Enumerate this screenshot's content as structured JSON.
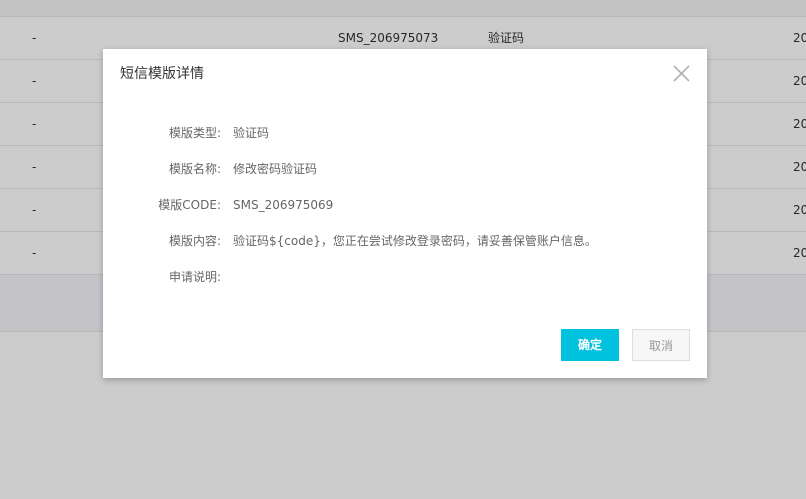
{
  "dialog": {
    "title": "短信模版详情",
    "fields": [
      {
        "label": "模版类型:",
        "value": "验证码"
      },
      {
        "label": "模版名称:",
        "value": "修改密码验证码"
      },
      {
        "label": "模版CODE:",
        "value": "SMS_206975069"
      },
      {
        "label": "模版内容:",
        "value": "验证码${code}，您正在尝试修改登录密码，请妥善保管账户信息。"
      },
      {
        "label": "申请说明:",
        "value": ""
      }
    ],
    "ok_label": "确定",
    "cancel_label": "取消",
    "close_icon": "close-icon"
  },
  "background_table": {
    "rows": [
      {
        "dash": "-",
        "code": "SMS_206975073",
        "type": "验证码",
        "date": "20"
      },
      {
        "dash": "-",
        "code": "",
        "type": "",
        "date": "20"
      },
      {
        "dash": "-",
        "code": "",
        "type": "",
        "date": "20"
      },
      {
        "dash": "-",
        "code": "",
        "type": "",
        "date": "20"
      },
      {
        "dash": "-",
        "code": "",
        "type": "",
        "date": "20"
      },
      {
        "dash": "-",
        "code": "",
        "type": "",
        "date": "20"
      }
    ]
  },
  "colors": {
    "primary_button": "#00c1de",
    "overlay": "rgba(0,0,0,0.2)"
  }
}
